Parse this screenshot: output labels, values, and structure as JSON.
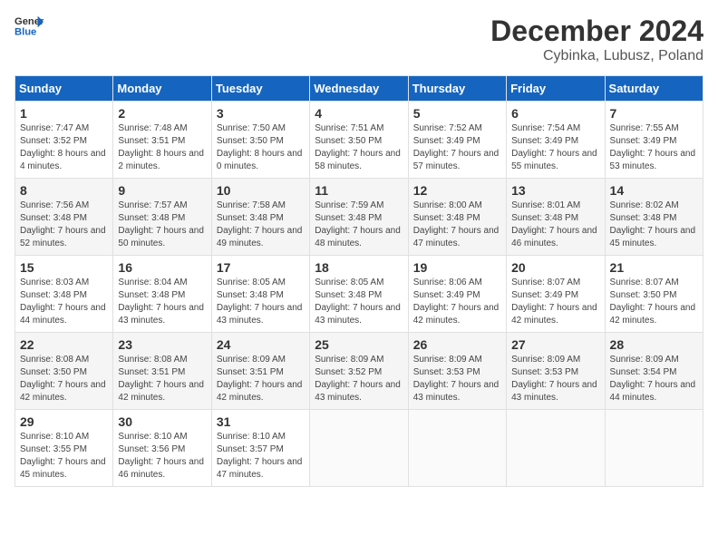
{
  "header": {
    "logo_general": "General",
    "logo_blue": "Blue",
    "month": "December 2024",
    "location": "Cybinka, Lubusz, Poland"
  },
  "days_of_week": [
    "Sunday",
    "Monday",
    "Tuesday",
    "Wednesday",
    "Thursday",
    "Friday",
    "Saturday"
  ],
  "weeks": [
    [
      {
        "day": "1",
        "sunrise": "7:47 AM",
        "sunset": "3:52 PM",
        "daylight": "8 hours and 4 minutes"
      },
      {
        "day": "2",
        "sunrise": "7:48 AM",
        "sunset": "3:51 PM",
        "daylight": "8 hours and 2 minutes"
      },
      {
        "day": "3",
        "sunrise": "7:50 AM",
        "sunset": "3:50 PM",
        "daylight": "8 hours and 0 minutes"
      },
      {
        "day": "4",
        "sunrise": "7:51 AM",
        "sunset": "3:50 PM",
        "daylight": "7 hours and 58 minutes"
      },
      {
        "day": "5",
        "sunrise": "7:52 AM",
        "sunset": "3:49 PM",
        "daylight": "7 hours and 57 minutes"
      },
      {
        "day": "6",
        "sunrise": "7:54 AM",
        "sunset": "3:49 PM",
        "daylight": "7 hours and 55 minutes"
      },
      {
        "day": "7",
        "sunrise": "7:55 AM",
        "sunset": "3:49 PM",
        "daylight": "7 hours and 53 minutes"
      }
    ],
    [
      {
        "day": "8",
        "sunrise": "7:56 AM",
        "sunset": "3:48 PM",
        "daylight": "7 hours and 52 minutes"
      },
      {
        "day": "9",
        "sunrise": "7:57 AM",
        "sunset": "3:48 PM",
        "daylight": "7 hours and 50 minutes"
      },
      {
        "day": "10",
        "sunrise": "7:58 AM",
        "sunset": "3:48 PM",
        "daylight": "7 hours and 49 minutes"
      },
      {
        "day": "11",
        "sunrise": "7:59 AM",
        "sunset": "3:48 PM",
        "daylight": "7 hours and 48 minutes"
      },
      {
        "day": "12",
        "sunrise": "8:00 AM",
        "sunset": "3:48 PM",
        "daylight": "7 hours and 47 minutes"
      },
      {
        "day": "13",
        "sunrise": "8:01 AM",
        "sunset": "3:48 PM",
        "daylight": "7 hours and 46 minutes"
      },
      {
        "day": "14",
        "sunrise": "8:02 AM",
        "sunset": "3:48 PM",
        "daylight": "7 hours and 45 minutes"
      }
    ],
    [
      {
        "day": "15",
        "sunrise": "8:03 AM",
        "sunset": "3:48 PM",
        "daylight": "7 hours and 44 minutes"
      },
      {
        "day": "16",
        "sunrise": "8:04 AM",
        "sunset": "3:48 PM",
        "daylight": "7 hours and 43 minutes"
      },
      {
        "day": "17",
        "sunrise": "8:05 AM",
        "sunset": "3:48 PM",
        "daylight": "7 hours and 43 minutes"
      },
      {
        "day": "18",
        "sunrise": "8:05 AM",
        "sunset": "3:48 PM",
        "daylight": "7 hours and 43 minutes"
      },
      {
        "day": "19",
        "sunrise": "8:06 AM",
        "sunset": "3:49 PM",
        "daylight": "7 hours and 42 minutes"
      },
      {
        "day": "20",
        "sunrise": "8:07 AM",
        "sunset": "3:49 PM",
        "daylight": "7 hours and 42 minutes"
      },
      {
        "day": "21",
        "sunrise": "8:07 AM",
        "sunset": "3:50 PM",
        "daylight": "7 hours and 42 minutes"
      }
    ],
    [
      {
        "day": "22",
        "sunrise": "8:08 AM",
        "sunset": "3:50 PM",
        "daylight": "7 hours and 42 minutes"
      },
      {
        "day": "23",
        "sunrise": "8:08 AM",
        "sunset": "3:51 PM",
        "daylight": "7 hours and 42 minutes"
      },
      {
        "day": "24",
        "sunrise": "8:09 AM",
        "sunset": "3:51 PM",
        "daylight": "7 hours and 42 minutes"
      },
      {
        "day": "25",
        "sunrise": "8:09 AM",
        "sunset": "3:52 PM",
        "daylight": "7 hours and 43 minutes"
      },
      {
        "day": "26",
        "sunrise": "8:09 AM",
        "sunset": "3:53 PM",
        "daylight": "7 hours and 43 minutes"
      },
      {
        "day": "27",
        "sunrise": "8:09 AM",
        "sunset": "3:53 PM",
        "daylight": "7 hours and 43 minutes"
      },
      {
        "day": "28",
        "sunrise": "8:09 AM",
        "sunset": "3:54 PM",
        "daylight": "7 hours and 44 minutes"
      }
    ],
    [
      {
        "day": "29",
        "sunrise": "8:10 AM",
        "sunset": "3:55 PM",
        "daylight": "7 hours and 45 minutes"
      },
      {
        "day": "30",
        "sunrise": "8:10 AM",
        "sunset": "3:56 PM",
        "daylight": "7 hours and 46 minutes"
      },
      {
        "day": "31",
        "sunrise": "8:10 AM",
        "sunset": "3:57 PM",
        "daylight": "7 hours and 47 minutes"
      },
      null,
      null,
      null,
      null
    ]
  ]
}
